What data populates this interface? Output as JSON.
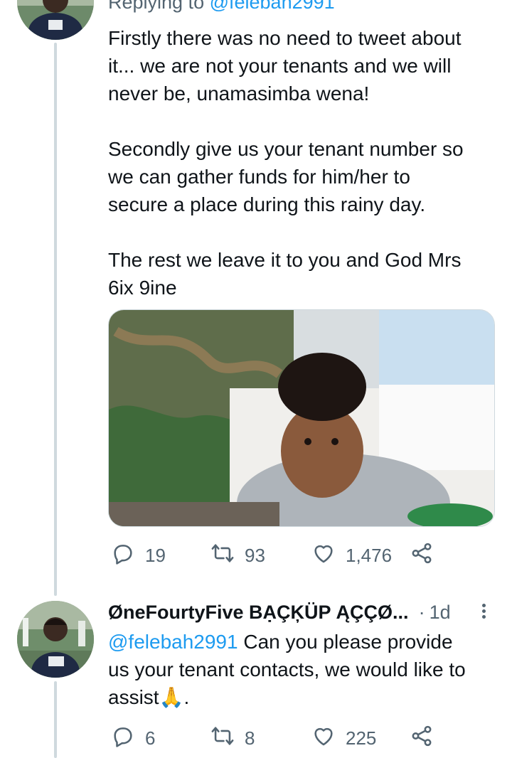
{
  "tweet1": {
    "replying_label": "Replying to ",
    "replying_handle": "@felebah2991",
    "text": "Firstly there was no need to tweet about\nit... we are not your tenants and we will\nnever be, unamasimba wena!\n\nSecondly give us your tenant number so\nwe can gather funds for him/her to\nsecure a place during this rainy day.\n\nThe rest we leave it to you and God Mrs\n6ix 9ine",
    "replies": "19",
    "retweets": "93",
    "likes": "1,476"
  },
  "tweet2": {
    "display_name": "ØneFourtyFive BẠÇĶÜP ĄÇÇØ...",
    "separator": "·",
    "time": "1d",
    "mention": "@felebah2991",
    "text_line1": " Can you please provide",
    "text_rest": "us your tenant contacts, we would like to\nassist",
    "emoji": "🙏",
    "text_end": ".",
    "replies": "6",
    "retweets": "8",
    "likes": "225"
  },
  "icons": [
    "reply-icon",
    "retweet-icon",
    "like-icon",
    "share-icon",
    "more-icon"
  ],
  "colors": {
    "accent": "#1d9bf0",
    "secondary_text": "#536471",
    "thread_line": "#cfd9de"
  }
}
